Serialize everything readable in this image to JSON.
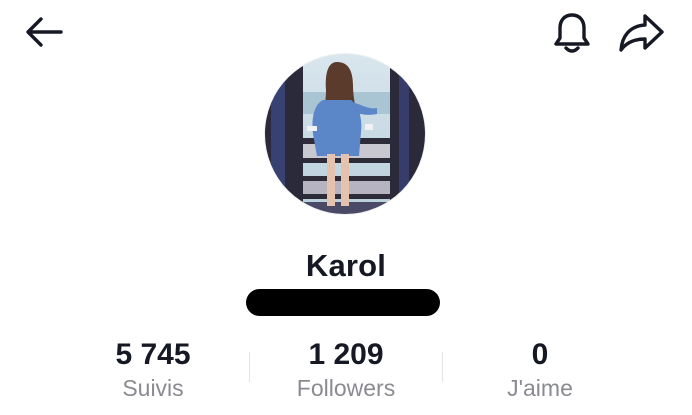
{
  "header": {
    "back_icon": "arrow-left-icon",
    "notification_icon": "bell-icon",
    "share_icon": "share-arrow-icon"
  },
  "profile": {
    "avatar_alt": "Profile photo",
    "username": "Karol"
  },
  "stats": [
    {
      "value": "5 745",
      "label": "Suivis"
    },
    {
      "value": "1 209",
      "label": "Followers"
    },
    {
      "value": "0",
      "label": "J'aime"
    }
  ],
  "colors": {
    "text_primary": "#161823",
    "text_secondary": "#8a8b91",
    "divider": "#e3e3e4",
    "redaction": "#000000"
  }
}
